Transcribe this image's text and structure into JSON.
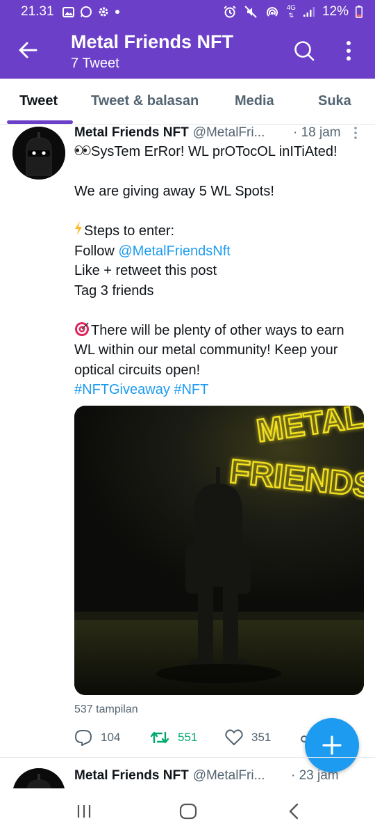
{
  "status_bar": {
    "time": "21.31",
    "network": "4G",
    "battery": "12%"
  },
  "app_bar": {
    "title": "Metal Friends NFT",
    "subtitle": "7 Tweet"
  },
  "tabs": [
    {
      "label": "Tweet",
      "active": true
    },
    {
      "label": "Tweet & balasan",
      "active": false
    },
    {
      "label": "Media",
      "active": false
    },
    {
      "label": "Suka",
      "active": false
    }
  ],
  "tweet": {
    "name": "Metal Friends NFT",
    "handle": "@MetalFri...",
    "time": "· 18 jam",
    "line1": "SysTem ErRor! WL prOTocOL inITiAted!",
    "line2": "We are giving away 5 WL Spots!",
    "line3": "Steps to enter:",
    "line4_prefix": "Follow ",
    "line4_mention": "@MetalFriendsNft",
    "line5": "Like + retweet this post",
    "line6": "Tag 3 friends",
    "line7": "There will be plenty of other ways to earn",
    "line8": "WL within our metal community! Keep your",
    "line9": "optical circuits open!",
    "hashtags": "#NFTGiveaway #NFT",
    "media_neon": [
      "METAL",
      "FRIENDS"
    ],
    "views": "537 tampilan",
    "replies": "104",
    "retweets": "551",
    "likes": "351"
  },
  "next_tweet": {
    "name": "Metal Friends NFT",
    "handle": "@MetalFri...",
    "time": "· 23 jam"
  },
  "colors": {
    "brand": "#6b3fc7",
    "link": "#1d9bf0",
    "retweet": "#00a86b",
    "neon": "#f2e01e"
  }
}
